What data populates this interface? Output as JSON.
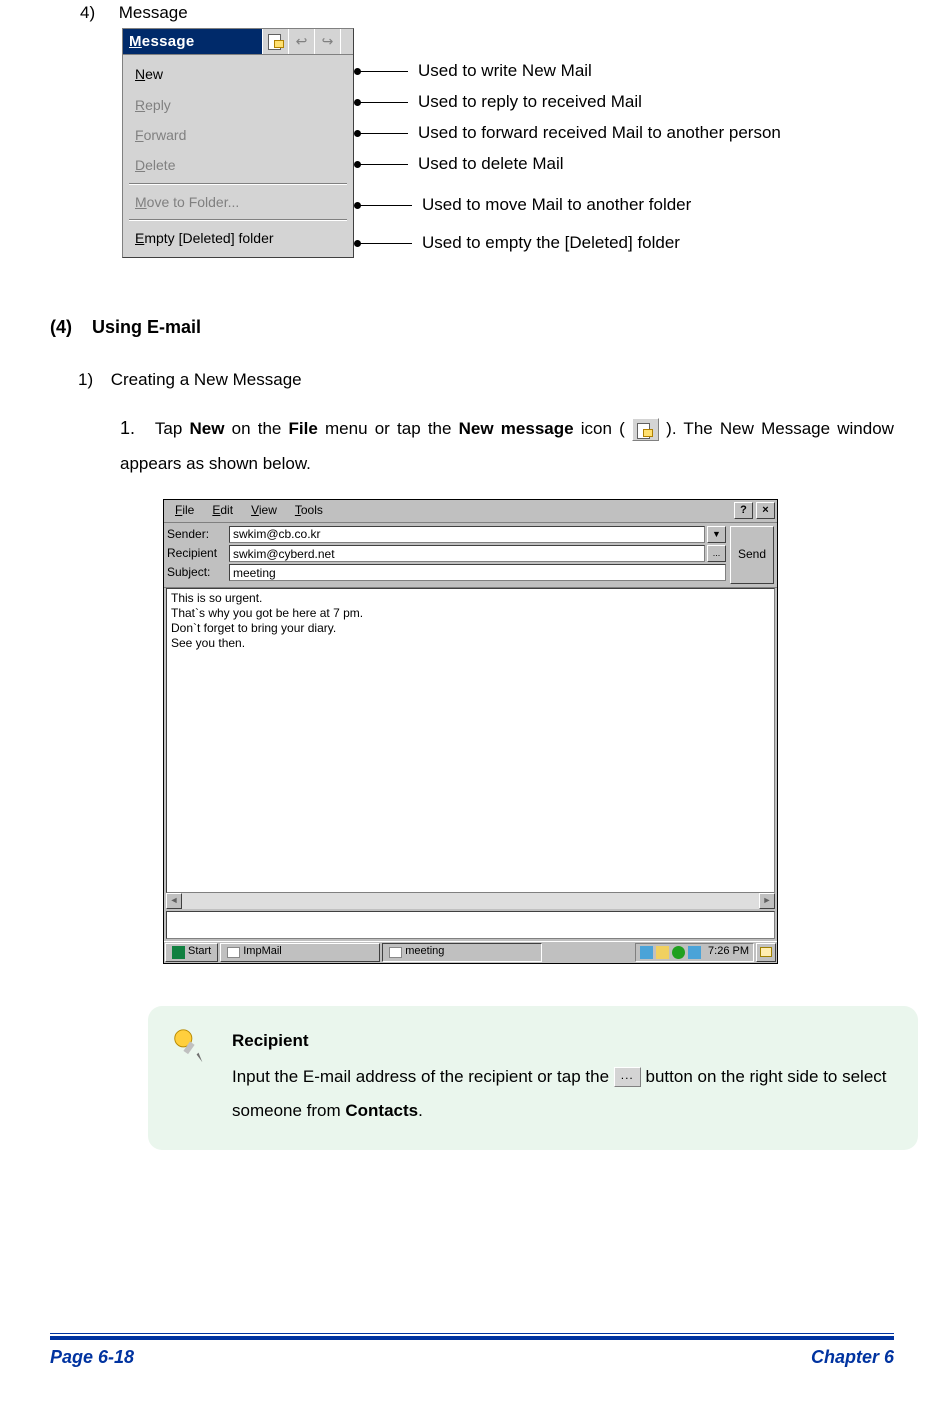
{
  "sec4": {
    "num": "4)",
    "title": "Message",
    "menu_title_html": "Message",
    "items": [
      {
        "label_u": "N",
        "label_rest": "ew",
        "enabled": true
      },
      {
        "label_u": "R",
        "label_rest": "eply",
        "enabled": false
      },
      {
        "label_u": "F",
        "label_rest": "orward",
        "enabled": false
      },
      {
        "label_u": "D",
        "label_rest": "elete",
        "enabled": false
      }
    ],
    "items_group2": [
      {
        "label_u": "M",
        "label_rest": "ove to Folder...",
        "enabled": false
      }
    ],
    "items_group3": [
      {
        "label_u": "E",
        "label_rest": "mpty [Deleted] folder",
        "enabled": true
      }
    ],
    "callouts": [
      "Used to write New Mail",
      "Used to reply to received Mail",
      "Used to forward received Mail to another person",
      "Used to delete Mail",
      "Used to move Mail to another folder",
      "Used to empty the [Deleted] folder"
    ]
  },
  "heading4": {
    "num": "(4)",
    "title": "Using E-mail"
  },
  "sub1": {
    "num": "1)",
    "title": "Creating a New Message",
    "step1_num": "1.",
    "step1_a": "Tap ",
    "step1_b": "New",
    "step1_c": " on the ",
    "step1_d": "File",
    "step1_e": " menu or tap the ",
    "step1_f": "New message",
    "step1_g": " icon ( ",
    "step1_h": " ). The New Message window appears as shown below."
  },
  "emailwin": {
    "menus": [
      {
        "u": "F",
        "rest": "ile"
      },
      {
        "u": "E",
        "rest": "dit"
      },
      {
        "u": "V",
        "rest": "iew"
      },
      {
        "u": "T",
        "rest": "ools"
      }
    ],
    "help_btn": "?",
    "close_btn": "×",
    "sender_label": "Sender:",
    "recipient_label": "Recipient",
    "subject_label": "Subject:",
    "sender_value": "swkim@cb.co.kr",
    "recipient_value": "swkim@cyberd.net",
    "subject_value": "meeting",
    "dots": "...",
    "send_label": "Send",
    "body_text": "This is so urgent.\nThat`s why you got be here at 7 pm.\nDon`t forget to bring your diary.\nSee you then.",
    "taskbar": {
      "start": "Start",
      "app1": "ImpMail",
      "app2": "meeting",
      "clock": "7:26 PM"
    }
  },
  "tip": {
    "title": "Recipient",
    "line_a": "Input the E-mail address of the recipient or tap the ",
    "line_b": " button on the right side to select someone from ",
    "contacts_word": "Contacts",
    "period": "."
  },
  "footer": {
    "left": "Page 6-18",
    "right": "Chapter 6"
  }
}
